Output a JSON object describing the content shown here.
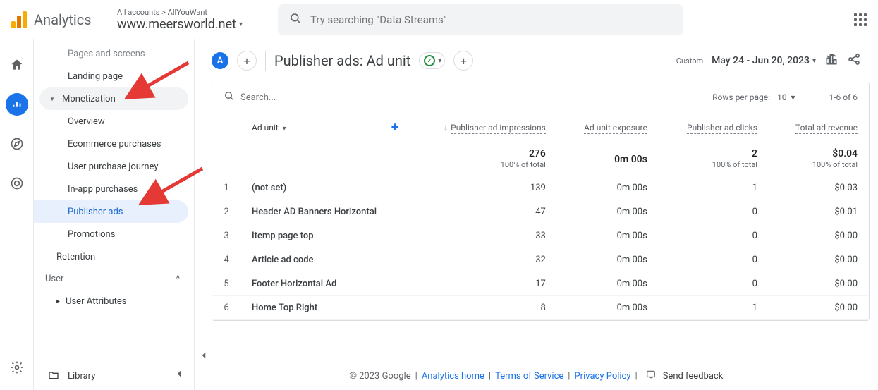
{
  "header": {
    "logo_text": "Analytics",
    "breadcrumb": "All accounts > AllYouWant",
    "property": "www.meersworld.net",
    "search_placeholder": "Try searching \"Data Streams\""
  },
  "nav": {
    "truncated_top": "Pages and screens",
    "landing": "Landing page",
    "monetization": "Monetization",
    "items": {
      "overview": "Overview",
      "ecommerce": "Ecommerce purchases",
      "journey": "User purchase journey",
      "inapp": "In-app purchases",
      "pubads": "Publisher ads",
      "promotions": "Promotions"
    },
    "retention": "Retention",
    "user": "User",
    "user_attr": "User Attributes",
    "library": "Library"
  },
  "toolbar": {
    "avatar": "A",
    "title": "Publisher ads: Ad unit",
    "custom_label": "Custom",
    "date_range": "May 24 - Jun 20, 2023"
  },
  "table": {
    "search_placeholder": "Search...",
    "rpp_label": "Rows per page:",
    "rpp_value": "10",
    "pager": "1-6 of 6",
    "cols": {
      "adunit": "Ad unit",
      "impressions": "Publisher ad impressions",
      "exposure": "Ad unit exposure",
      "clicks": "Publisher ad clicks",
      "revenue": "Total ad revenue"
    },
    "totals": {
      "impressions": "276",
      "impressions_pct": "100% of total",
      "exposure": "0m 00s",
      "clicks": "2",
      "clicks_pct": "100% of total",
      "revenue": "$0.04",
      "revenue_pct": "100% of total"
    },
    "rows": [
      {
        "idx": "1",
        "name": "(not set)",
        "impr": "139",
        "exp": "0m 00s",
        "clk": "1",
        "rev": "$0.03"
      },
      {
        "idx": "2",
        "name": "Header AD Banners Horizontal",
        "impr": "47",
        "exp": "0m 00s",
        "clk": "0",
        "rev": "$0.01"
      },
      {
        "idx": "3",
        "name": "Itemp page top",
        "impr": "33",
        "exp": "0m 00s",
        "clk": "0",
        "rev": "$0.00"
      },
      {
        "idx": "4",
        "name": "Article ad code",
        "impr": "32",
        "exp": "0m 00s",
        "clk": "0",
        "rev": "$0.00"
      },
      {
        "idx": "5",
        "name": "Footer Horizontal Ad",
        "impr": "17",
        "exp": "0m 00s",
        "clk": "0",
        "rev": "$0.00"
      },
      {
        "idx": "6",
        "name": "Home Top Right",
        "impr": "8",
        "exp": "0m 00s",
        "clk": "1",
        "rev": "$0.00"
      }
    ]
  },
  "footer": {
    "copyright": "© 2023 Google",
    "home": "Analytics home",
    "tos": "Terms of Service",
    "privacy": "Privacy Policy",
    "feedback": "Send feedback"
  }
}
